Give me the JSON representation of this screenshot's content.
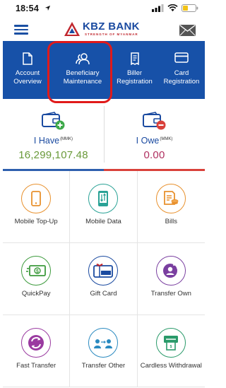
{
  "status_bar": {
    "time": "18:54"
  },
  "header": {
    "bank_name": "KBZ BANK",
    "tagline": "STRENGTH OF MYANMAR"
  },
  "nav": {
    "items": [
      {
        "label": "Account\nOverview",
        "icon": "document-icon"
      },
      {
        "label": "Beneficiary\nMaintenance",
        "icon": "users-icon"
      },
      {
        "label": "Biller\nRegistration",
        "icon": "receipt-icon"
      },
      {
        "label": "Card\nRegistration",
        "icon": "card-icon"
      }
    ]
  },
  "balance": {
    "have_label": "I Have",
    "owe_label": "I Owe",
    "currency": "(MMK)",
    "have_value": "16,299,107.48",
    "owe_value": "0.00",
    "have_color": "#6a9a3a",
    "owe_color": "#b03060"
  },
  "tiles": [
    {
      "label": "Mobile Top-Up",
      "icon": "mobile-icon",
      "color": "#e8912e"
    },
    {
      "label": "Mobile Data",
      "icon": "mobile-data-icon",
      "color": "#2aa296"
    },
    {
      "label": "Bills",
      "icon": "bills-icon",
      "color": "#e8912e"
    },
    {
      "label": "QuickPay",
      "icon": "cash-icon",
      "color": "#3c9a3c"
    },
    {
      "label": "Gift Card",
      "icon": "gift-card-icon",
      "color": "#1a4aa0"
    },
    {
      "label": "Transfer Own",
      "icon": "transfer-own-icon",
      "color": "#7a3fa0"
    },
    {
      "label": "Fast Transfer",
      "icon": "fast-transfer-icon",
      "color": "#9a3aa0"
    },
    {
      "label": "Transfer Other",
      "icon": "transfer-other-icon",
      "color": "#2a8ac0"
    },
    {
      "label": "Cardless Withdrawal",
      "icon": "atm-icon",
      "color": "#2a9a6a"
    }
  ],
  "colors": {
    "brand_blue": "#1751a8",
    "highlight_red": "#e01a1a"
  }
}
